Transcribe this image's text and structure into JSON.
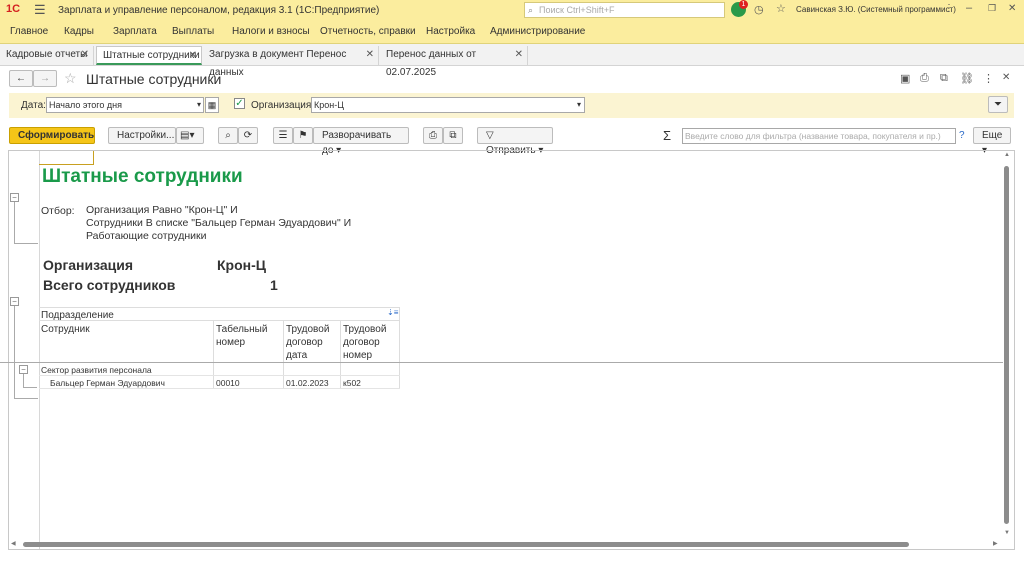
{
  "app": {
    "logo": "1С",
    "title": "Зарплата и управление персоналом, редакция 3.1  (1С:Предприятие)",
    "search_placeholder": "Поиск Ctrl+Shift+F",
    "notif_count": "1",
    "user": "Савинская З.Ю. (Системный программист)"
  },
  "menu": [
    "Главное",
    "Кадры",
    "Зарплата",
    "Выплаты",
    "Налоги и взносы",
    "Отчетность, справки",
    "Настройка",
    "Администрирование"
  ],
  "tabs": [
    "Кадровые отчеты",
    "Штатные сотрудники",
    "Загрузка в документ Перенос данных",
    "Перенос данных  от 02.07.2025"
  ],
  "form": {
    "title": "Штатные сотрудники",
    "date_label": "Дата:",
    "date_value": "Начало этого дня",
    "org_label": "Организация:",
    "org_value": "Крон-Ц"
  },
  "toolbar": {
    "generate": "Сформировать",
    "settings": "Настройки...",
    "expand": "Разворачивать до",
    "send": "Отправить",
    "filter_placeholder": "Введите слово для фильтра (название товара, покупателя и пр.)",
    "help": "?",
    "more": "Еще"
  },
  "report": {
    "title": "Штатные сотрудники",
    "filter_label": "Отбор:",
    "filter_lines": [
      "Организация Равно \"Крон-Ц\" И",
      "Сотрудники В списке \"Бальцер Герман Эдуардович\" И",
      "Работающие сотрудники"
    ],
    "org_label": "Организация",
    "org_value": "Крон-Ц",
    "count_label": "Всего сотрудников",
    "count_value": "1",
    "group_header": "Подразделение",
    "columns": [
      "Сотрудник",
      "Табельный номер",
      "Трудовой договор дата",
      "Трудовой договор номер"
    ],
    "group_name": "Сектор развития персонала",
    "rows": [
      {
        "name": "Бальцер Герман Эдуардович",
        "tab": "00010",
        "date": "01.02.2023",
        "num": "к502"
      }
    ]
  },
  "colors": {
    "accent": "#fbed9e",
    "title_green": "#1a9a4a",
    "generate_btn": "#f5c518"
  }
}
